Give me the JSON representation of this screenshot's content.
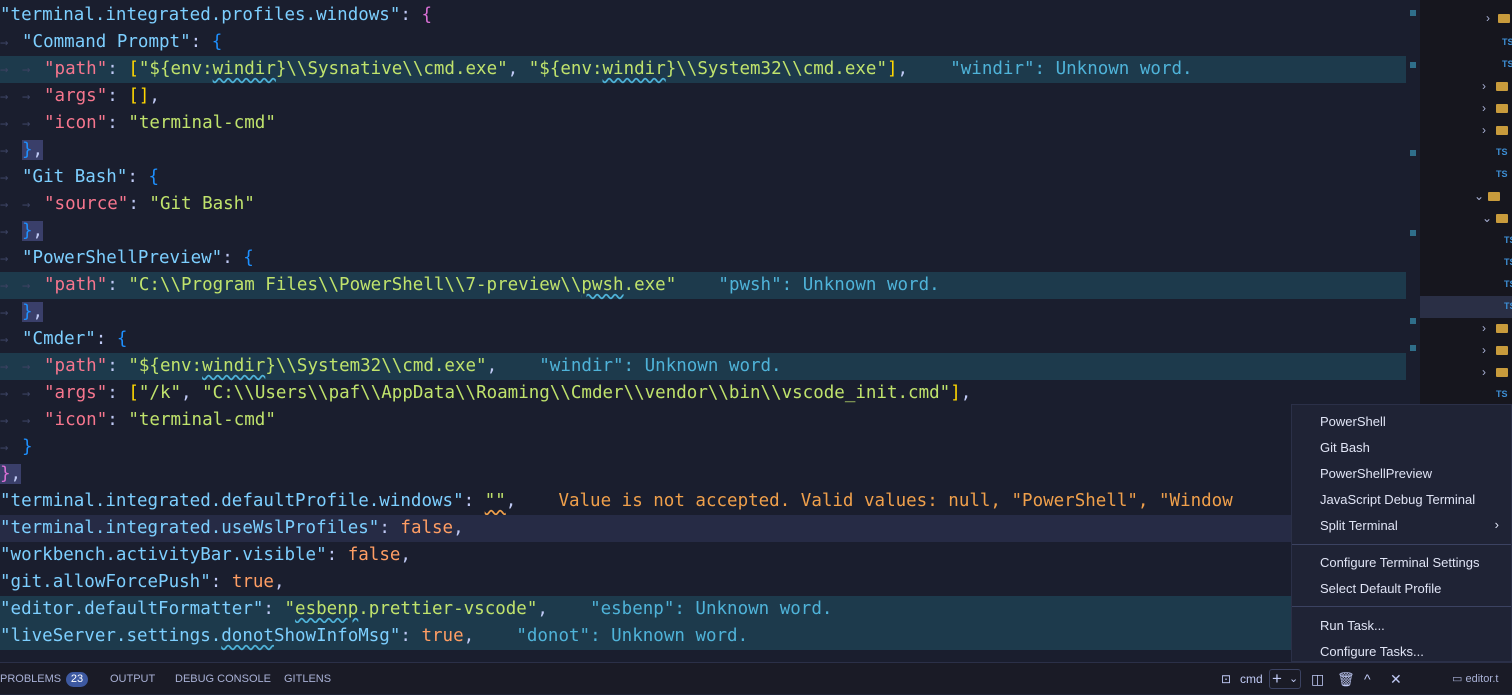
{
  "editor": {
    "lines": [
      {
        "key": "terminal.integrated.profiles.windows"
      },
      {
        "key": "Command Prompt"
      },
      {
        "path_a": "${env:",
        "path_a2": "windir",
        "path_a3": "}\\\\Sysnative\\\\cmd.exe",
        "path_b": "${env:",
        "path_b2": "windir",
        "path_b3": "}\\\\System32\\\\cmd.exe",
        "diag": "\"windir\": Unknown word."
      },
      {
        "args": "[]"
      },
      {
        "icon": "terminal-cmd"
      },
      {
        "key": "Git Bash"
      },
      {
        "source": "Git Bash"
      },
      {
        "key": "PowerShellPreview"
      },
      {
        "path_a": "C:\\\\Program Files\\\\PowerShell\\\\7-preview\\\\",
        "path_a2": "pwsh",
        "path_a3": ".exe",
        "diag": "\"pwsh\": Unknown word."
      },
      {
        "key": "Cmder"
      },
      {
        "path_a": "${env:",
        "path_a2": "windir",
        "path_a3": "}\\\\System32\\\\cmd.exe",
        "diag": "\"windir\": Unknown word."
      },
      {
        "args_a": "/k",
        "args_b": "C:\\\\Users\\\\paf\\\\AppData\\\\Roaming\\\\Cmder\\\\vendor\\\\bin\\\\vscode_init.cmd"
      },
      {
        "icon": "terminal-cmd"
      },
      {
        "key": "terminal.integrated.defaultProfile.windows",
        "value": "",
        "diag": "Value is not accepted. Valid values: null, \"PowerShell\", \"Window"
      },
      {
        "key": "terminal.integrated.useWslProfiles",
        "value": "false"
      },
      {
        "key": "workbench.activityBar.visible",
        "value": "false"
      },
      {
        "key": "git.allowForcePush",
        "value": "true"
      },
      {
        "key": "editor.defaultFormatter",
        "value": "esbenp.prettier-vscode",
        "value_sq": "esbenp",
        "value_rest": ".prettier-vscode",
        "diag": "\"esbenp\": Unknown word."
      },
      {
        "key_a": "liveServer.settings.",
        "key_sq": "donot",
        "key_b": "ShowInfoMsg",
        "value": "true",
        "diag": "\"donot\": Unknown word."
      }
    ],
    "labels": {
      "path": "path",
      "args": "args",
      "icon": "icon",
      "source": "source"
    }
  },
  "menu": {
    "items": [
      "PowerShell",
      "Git Bash",
      "PowerShellPreview",
      "JavaScript Debug Terminal",
      "Split Terminal"
    ],
    "settings": [
      "Configure Terminal Settings",
      "Select Default Profile"
    ],
    "tasks": [
      "Run Task...",
      "Configure Tasks..."
    ]
  },
  "panel": {
    "tabs": [
      "PROBLEMS",
      "OUTPUT",
      "DEBUG CONSOLE",
      "GITLENS"
    ],
    "problems_count": "23",
    "terminal_name": "cmd",
    "editor_tab": "editor.t"
  },
  "sidebar": {
    "ts_label": "TS"
  },
  "colors": {
    "accent": "#3d59a1",
    "key": "#7dcfff",
    "string": "#9ece6a",
    "warning": "#f0a04b"
  }
}
